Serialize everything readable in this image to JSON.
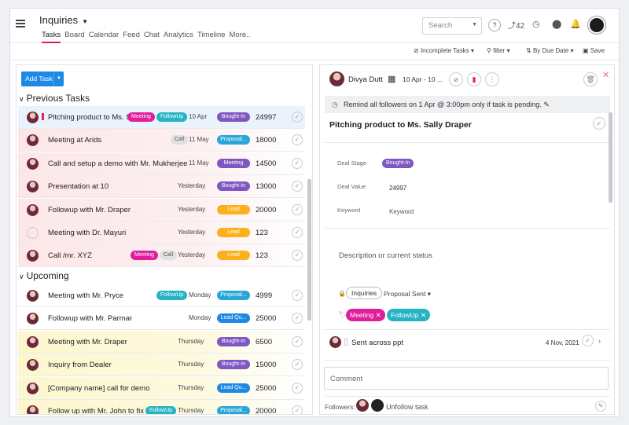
{
  "header": {
    "title": "Inquiries",
    "tabs": [
      "Tasks",
      "Board",
      "Calendar",
      "Feed",
      "Chat",
      "Analytics",
      "Timeline",
      "More.."
    ],
    "search_placeholder": "Search",
    "notif_count": "42"
  },
  "toolbar": {
    "incomplete": "Incomplete Tasks",
    "filter": "filter",
    "sort": "By Due Date",
    "save": "Save"
  },
  "list": {
    "add_task": "Add Task",
    "previous_label": "Previous Tasks",
    "upcoming_label": "Upcoming",
    "previous": [
      {
        "title": "Pitching product to Ms. Sa",
        "tags": [
          "Meeting",
          "FollowUp"
        ],
        "date": "10 Apr",
        "stage": "Bought-In",
        "stage_color": "#7e57c2",
        "value": "24997"
      },
      {
        "title": "Meeting at Arids",
        "tags": [
          "Call"
        ],
        "date": "11 May",
        "stage": "Proposal...",
        "stage_color": "#29a6d8",
        "value": "18000"
      },
      {
        "title": "Call and setup a demo with Mr. Mukherjee",
        "tags": [],
        "date": "11 May",
        "stage": "Meeting",
        "stage_color": "#7e57c2",
        "value": "14500"
      },
      {
        "title": "Presentation at 10",
        "tags": [],
        "date": "Yesterday",
        "stage": "Bought-In",
        "stage_color": "#7e57c2",
        "value": "13000"
      },
      {
        "title": "Followup with Mr. Draper",
        "tags": [],
        "date": "Yesterday",
        "stage": "Lead",
        "stage_color": "#fbb11b",
        "value": "20000"
      },
      {
        "title": "Meeting with Dr. Mayuri",
        "tags": [],
        "date": "Yesterday",
        "stage": "Lead",
        "stage_color": "#fbb11b",
        "value": "123"
      },
      {
        "title": "Call /mr. XYZ",
        "tags": [
          "Meeting",
          "Call"
        ],
        "date": "Yesterday",
        "stage": "Lead",
        "stage_color": "#fbb11b",
        "value": "123"
      }
    ],
    "upcoming": [
      {
        "title": "Meeting with Mr. Pryce",
        "tags": [
          "FollowUp"
        ],
        "date": "Monday",
        "stage": "Proposal...",
        "stage_color": "#29a6d8",
        "value": "4999"
      },
      {
        "title": "Followup with Mr. Parmar",
        "tags": [],
        "date": "Monday",
        "stage": "Lead Qu...",
        "stage_color": "#1e88e5",
        "value": "25000"
      },
      {
        "title": "Meeting with Mr. Draper",
        "tags": [],
        "date": "Thursday",
        "stage": "Bought-In",
        "stage_color": "#7e57c2",
        "value": "6500"
      },
      {
        "title": "Inquiry from Dealer",
        "tags": [],
        "date": "Thursday",
        "stage": "Bought-In",
        "stage_color": "#7e57c2",
        "value": "15000"
      },
      {
        "title": "[Company name] call for demo",
        "tags": [],
        "date": "Thursday",
        "stage": "Lead Qu...",
        "stage_color": "#1e88e5",
        "value": "25000"
      },
      {
        "title": "Follow up with Mr. John to fix a m",
        "tags": [
          "FollowUp"
        ],
        "date": "Thursday",
        "stage": "Proposal...",
        "stage_color": "#29a6d8",
        "value": "20000"
      }
    ]
  },
  "detail": {
    "assignee": "Divya Dutt",
    "date_range": "10 Apr - 10 ...",
    "reminder": "Remind all followers on 1 Apr @ 3:00pm only if task is pending.",
    "title": "Pitching product to Ms. Sally Draper",
    "deal_stage_label": "Deal Stage",
    "deal_stage": "Bought-In",
    "deal_value_label": "Deal Value",
    "deal_value": "24997",
    "keyword_label": "Keyword",
    "keyword_placeholder": "Keyword",
    "description_placeholder": "Description or current status",
    "board": "Inquiries",
    "status": "Proposal Sent",
    "tags": [
      "Meeting",
      "FollowUp"
    ],
    "activity_text": "Sent across ppt",
    "activity_date": "4 Nov, 2021",
    "comment_placeholder": "Comment",
    "followers_label": "Followers:",
    "unfollow": "Unfollow task"
  }
}
